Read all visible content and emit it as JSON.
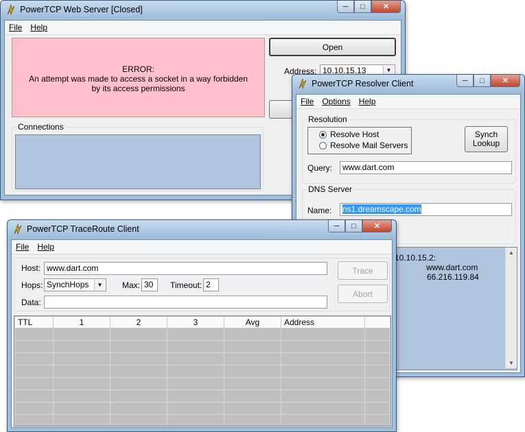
{
  "web_server": {
    "title": "PowerTCP Web Server  [Closed]",
    "menu": [
      "File",
      "Help"
    ],
    "error_heading": "ERROR:",
    "error_message": "An attempt was made to access a socket in a way forbidden by its access permissions",
    "open_button": "Open",
    "address_label": "Address:",
    "address_value": "10.10.15.13",
    "connections_label": "Connections"
  },
  "resolver": {
    "title": "PowerTCP Resolver Client",
    "menu": [
      "File",
      "Options",
      "Help"
    ],
    "resolution_label": "Resolution",
    "option_host": "Resolve Host",
    "option_mail": "Resolve Mail Servers",
    "synch_button": "Synch\nLookup",
    "query_label": "Query:",
    "query_value": "www.dart.com",
    "dns_label": "DNS Server",
    "name_label": "Name:",
    "name_value": "ns1.dreamscape.com",
    "output_lines": [
      "10.10.15.2:",
      "www.dart.com",
      "66.216.119.84"
    ]
  },
  "traceroute": {
    "title": "PowerTCP TraceRoute Client",
    "menu": [
      "File",
      "Help"
    ],
    "host_label": "Host:",
    "host_value": "www.dart.com",
    "hops_label": "Hops:",
    "hops_value": "SynchHops",
    "max_label": "Max:",
    "max_value": "30",
    "timeout_label": "Timeout:",
    "timeout_value": "2",
    "data_label": "Data:",
    "data_value": "",
    "trace_button": "Trace",
    "abort_button": "Abort",
    "columns": [
      "TTL",
      "1",
      "2",
      "3",
      "Avg",
      "Address",
      ""
    ]
  },
  "colors": {
    "error_bg": "#ffc0cb",
    "list_bg": "#b0c4de",
    "grid_bg": "#c0c0c0"
  }
}
